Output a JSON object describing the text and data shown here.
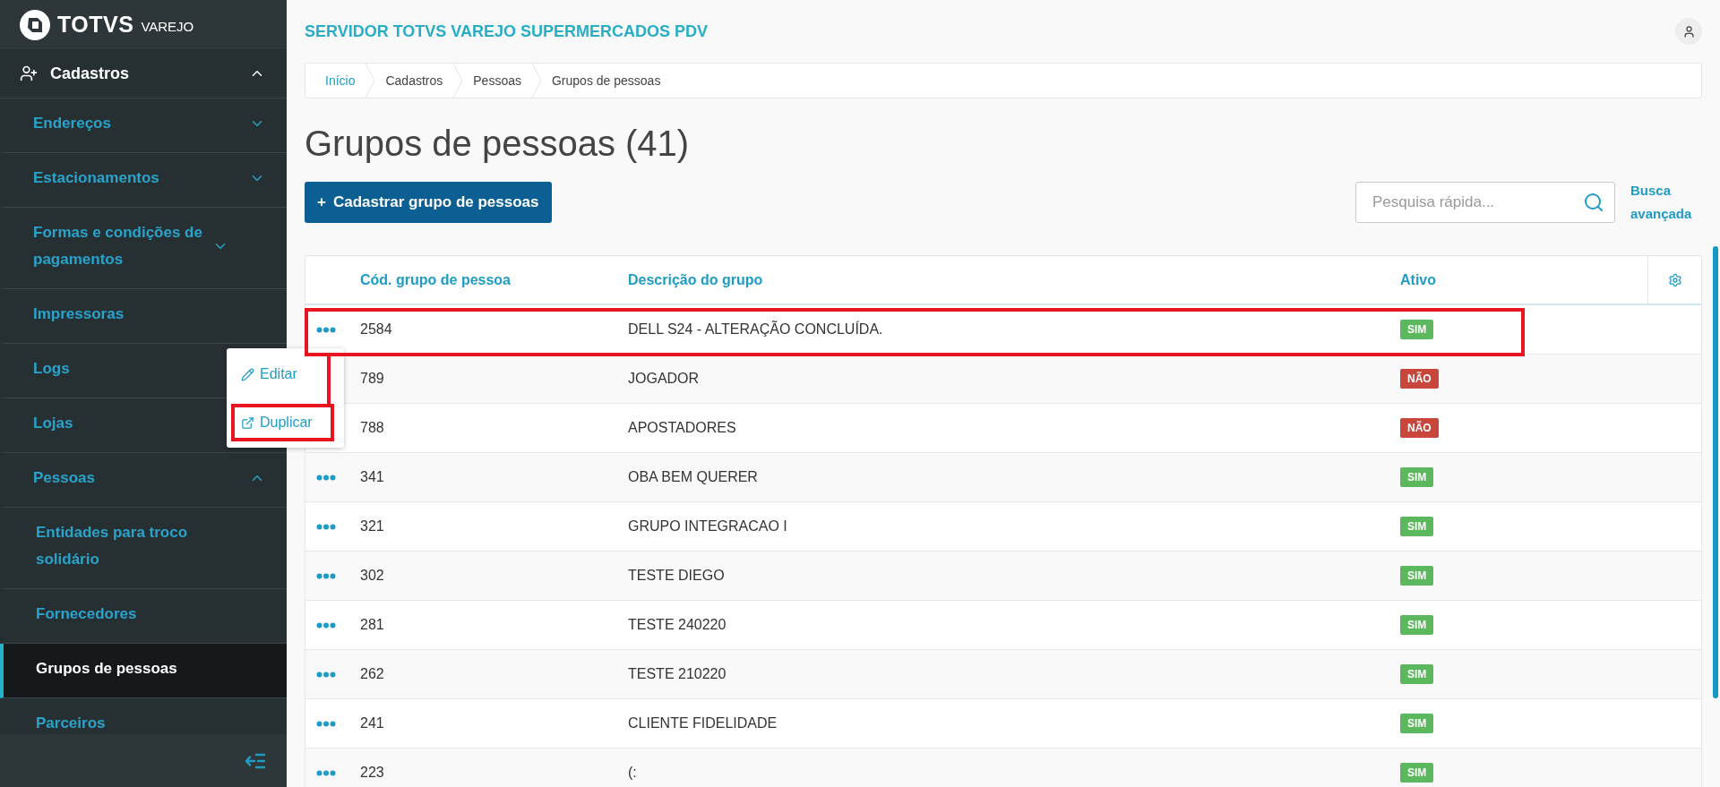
{
  "logo": {
    "brand": "TOTVS",
    "product": "VAREJO"
  },
  "sidebar": {
    "section": {
      "label": "Cadastros",
      "expanded": true,
      "items": [
        {
          "label": "Endereços",
          "expanded": false,
          "selected": false
        },
        {
          "label": "Estacionamentos",
          "expanded": false,
          "selected": false
        },
        {
          "label": "Formas e condições de pagamentos",
          "expanded": false,
          "selected": false
        },
        {
          "label": "Impressoras",
          "selected": false
        },
        {
          "label": "Logs",
          "selected": false
        },
        {
          "label": "Lojas",
          "selected": false
        },
        {
          "label": "Pessoas",
          "expanded": true,
          "selected": false,
          "children": [
            {
              "label": "Entidades para troco solidário",
              "selected": false
            },
            {
              "label": "Fornecedores",
              "selected": false
            },
            {
              "label": "Grupos de pessoas",
              "selected": true
            },
            {
              "label": "Parceiros",
              "selected": false
            }
          ]
        }
      ]
    }
  },
  "header": {
    "title": "SERVIDOR TOTVS VAREJO SUPERMERCADOS PDV"
  },
  "breadcrumb": [
    "Início",
    "Cadastros",
    "Pessoas",
    "Grupos de pessoas"
  ],
  "page_title": "Grupos de pessoas (41)",
  "add_button": {
    "icon": "+",
    "label": "Cadastrar grupo de pessoas"
  },
  "search": {
    "placeholder": "Pesquisa rápida..."
  },
  "advanced_search": "Busca avançada",
  "table": {
    "columns": [
      "Cód. grupo de pessoa",
      "Descrição do grupo",
      "Ativo"
    ],
    "rows": [
      {
        "code": "2584",
        "description": "DELL S24 - ALTERAÇÃO CONCLUÍDA.",
        "active": true,
        "status": "SIM",
        "actions": true
      },
      {
        "code": "789",
        "description": "JOGADOR",
        "active": false,
        "status": "NÃO",
        "actions": false
      },
      {
        "code": "788",
        "description": "APOSTADORES",
        "active": false,
        "status": "NÃO",
        "actions": false
      },
      {
        "code": "341",
        "description": "OBA BEM QUERER",
        "active": true,
        "status": "SIM",
        "actions": true
      },
      {
        "code": "321",
        "description": "GRUPO INTEGRACAO I",
        "active": true,
        "status": "SIM",
        "actions": true
      },
      {
        "code": "302",
        "description": "TESTE DIEGO",
        "active": true,
        "status": "SIM",
        "actions": true
      },
      {
        "code": "281",
        "description": "TESTE 240220",
        "active": true,
        "status": "SIM",
        "actions": true
      },
      {
        "code": "262",
        "description": "TESTE 210220",
        "active": true,
        "status": "SIM",
        "actions": true
      },
      {
        "code": "241",
        "description": "CLIENTE FIDELIDADE",
        "active": true,
        "status": "SIM",
        "actions": true
      },
      {
        "code": "223",
        "description": "(:",
        "active": true,
        "status": "SIM",
        "actions": true
      }
    ]
  },
  "row_menu": [
    {
      "kind": "edit",
      "label": "Editar"
    },
    {
      "kind": "duplicate",
      "label": "Duplicar"
    }
  ]
}
